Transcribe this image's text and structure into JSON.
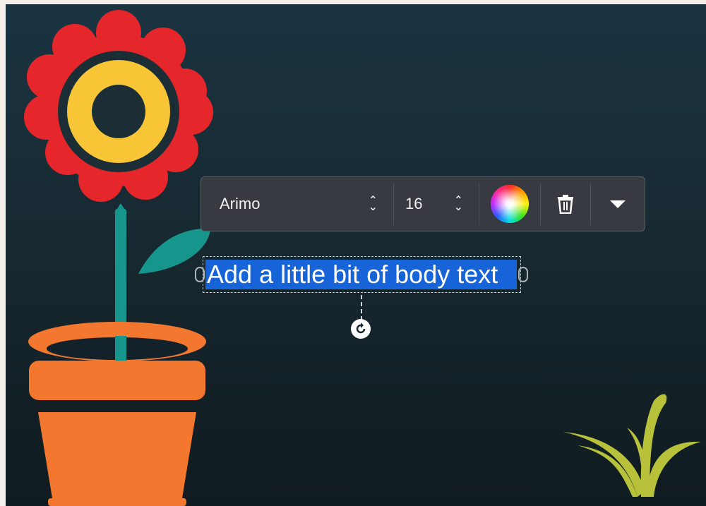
{
  "toolbar": {
    "font_family": "Arimo",
    "font_size": "16",
    "icons": {
      "font_stepper": "updown-chevrons-icon",
      "size_stepper": "updown-chevrons-icon",
      "color": "color-wheel-icon",
      "delete": "trash-icon",
      "more": "caret-down-icon"
    }
  },
  "textbox": {
    "text": "Add a little bit of body text",
    "selection_color": "#1664d8"
  },
  "colors": {
    "canvas_top": "#1b3442",
    "canvas_bottom": "#0f1b20",
    "petal_red": "#e5262b",
    "flower_center": "#f7c536",
    "stem_teal": "#16958c",
    "pot_orange": "#f4772f",
    "grass_yellow_green": "#b8c13a"
  }
}
